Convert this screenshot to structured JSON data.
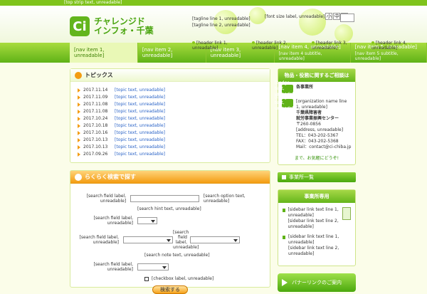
{
  "top_strip": {
    "text": "[top strip text, unreadable]"
  },
  "header": {
    "logo_mark": "Ci",
    "logo_text_line1": "チャレンジド",
    "logo_text_line2": "インフォ・千葉",
    "tagline_line1": "[tagline line 1, unreadable]",
    "tagline_line2": "[tagline line 2, unreadable]",
    "font_size_label": "[font size label, unreadable]",
    "font_size_small": "小",
    "font_size_medium": "中",
    "font_size_large": "大",
    "util_links": [
      "[header link 1, unreadable]",
      "[header link 2, unreadable]",
      "[header link 3, unreadable]",
      "[header link 4, unreadable]"
    ]
  },
  "nav": {
    "items": [
      {
        "label": "[nav item 1, unreadable]",
        "sub": ""
      },
      {
        "label": "[nav item 2, unreadable]",
        "sub": ""
      },
      {
        "label": "[nav item 3, unreadable]",
        "sub": ""
      },
      {
        "label": "[nav item 4, unreadable]",
        "sub": "[nav item 4 subtitle, unreadable]"
      },
      {
        "label": "[nav item 5, unreadable]",
        "sub": "[nav item 5 subtitle, unreadable]"
      }
    ]
  },
  "topics": {
    "title": "トピックス",
    "items": [
      {
        "date": "2017.11.14",
        "text": "[topic text, unreadable]"
      },
      {
        "date": "2017.11.09",
        "text": "[topic text, unreadable]"
      },
      {
        "date": "2017.11.08",
        "text": "[topic text, unreadable]"
      },
      {
        "date": "2017.11.08",
        "text": "[topic text, unreadable]"
      },
      {
        "date": "2017.10.24",
        "text": "[topic text, unreadable]"
      },
      {
        "date": "2017.10.18",
        "text": "[topic text, unreadable]"
      },
      {
        "date": "2017.10.16",
        "text": "[topic text, unreadable]"
      },
      {
        "date": "2017.10.13",
        "text": "[topic text, unreadable]"
      },
      {
        "date": "2017.10.13",
        "text": "[topic text, unreadable]"
      },
      {
        "date": "2017.09.26",
        "text": "[topic text, unreadable]"
      }
    ]
  },
  "search": {
    "title": "らくらく検索で探す",
    "row1_label": "[search field label, unreadable]",
    "row1_hint": "[search hint text, unreadable]",
    "row1_option": "[search option text, unreadable]",
    "row2_label": "[search field label, unreadable]",
    "row3_label_left": "[search field label, unreadable]",
    "row3_label_right": "[search field label, unreadable]",
    "row3_note": "[search note text, unreadable]",
    "row4_label": "[search field label, unreadable]",
    "checkbox_label": "[checkbox label, unreadable]",
    "submit": "検索する"
  },
  "sidebar": {
    "consult_title": "物品・役務に関するご相談は",
    "office_badge": "[badge text, unreadable]",
    "office_title": "各事業所",
    "or_badge": "[badge text, unreadable]",
    "org_line1": "[organization name line 1, unreadable]",
    "org_line2": "千葉県障害者",
    "org_line3": "就労事業振興センター",
    "postal": "〒260-0856",
    "address": "[address, unreadable]",
    "tel": "TEL：043-202-5367",
    "fax": "FAX：043-202-5368",
    "mail": "Mail：contact@ci-chiba.jp",
    "closing": "まで、お気軽にどうぞ!",
    "office_list_btn": "事業所一覧",
    "members_title": "事業所専用",
    "members_item1_line1": "[sidebar link text line 1, unreadable]",
    "members_item1_line2": "[sidebar link text line 2, unreadable]",
    "members_item2_line1": "[sidebar link text line 1, unreadable]",
    "members_item2_line2": "[sidebar link text line 2, unreadable]",
    "banner_link": "バナーリンクのご案内"
  }
}
